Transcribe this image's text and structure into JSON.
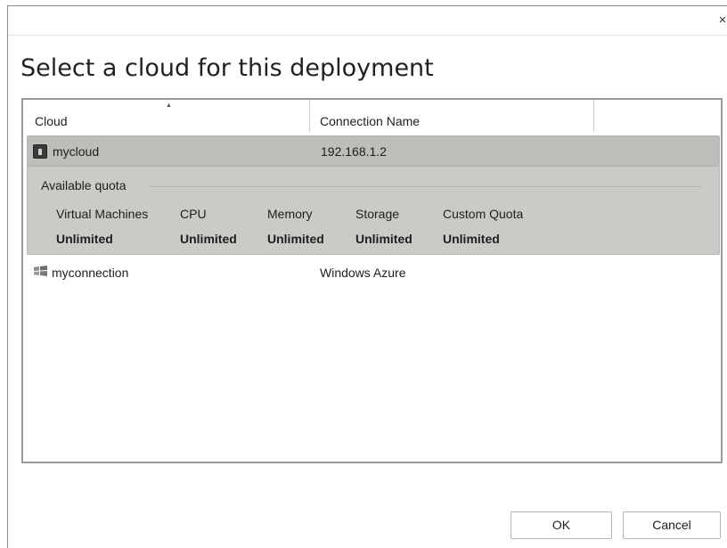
{
  "dialog": {
    "close_glyph": "×",
    "title": "Select a cloud for this deployment"
  },
  "table": {
    "columns": [
      "Cloud",
      "Connection Name"
    ],
    "rows": [
      {
        "name": "mycloud",
        "connection": "192.168.1.2",
        "icon": "cloud-server-icon",
        "selected": true,
        "quota": {
          "title": "Available quota",
          "items": [
            {
              "label": "Virtual Machines",
              "value": "Unlimited"
            },
            {
              "label": "CPU",
              "value": "Unlimited"
            },
            {
              "label": "Memory",
              "value": "Unlimited"
            },
            {
              "label": "Storage",
              "value": "Unlimited"
            },
            {
              "label": "Custom Quota",
              "value": "Unlimited"
            }
          ]
        }
      },
      {
        "name": "myconnection",
        "connection": "Windows Azure",
        "icon": "windows-azure-icon",
        "selected": false
      }
    ]
  },
  "buttons": {
    "ok": "OK",
    "cancel": "Cancel"
  },
  "colors": {
    "selected_row": "#cacac7",
    "selected_row_header": "#bdbdb9",
    "border": "#9a9a9a"
  }
}
